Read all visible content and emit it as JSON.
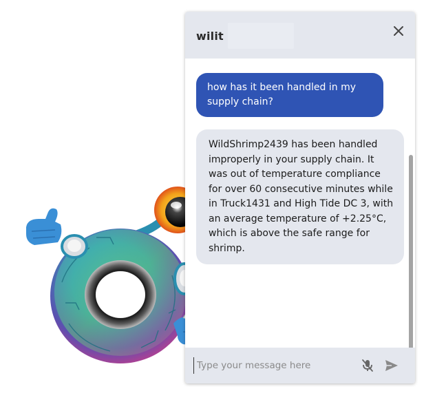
{
  "header": {
    "logo_text": "wili",
    "logo_tail": "t",
    "close_icon": "close-icon"
  },
  "messages": [
    {
      "role": "user",
      "text": "how has it been handled in my supply chain?"
    },
    {
      "role": "assistant",
      "text": "WildShrimp2439 has been handled improperly in your supply chain. It was out of temperature compliance for over 60 consecutive minutes while in Truck1431 and High Tide DC 3, with an average temperature of +2.25°C, which is above the safe range for shrimp."
    }
  ],
  "composer": {
    "placeholder": "Type your message here",
    "mic_icon": "mic-off-icon",
    "send_icon": "send-icon"
  },
  "colors": {
    "user_bubble": "#2f54b4",
    "bot_bubble": "#e4e7ee",
    "header_bg": "#e4e7ee"
  }
}
